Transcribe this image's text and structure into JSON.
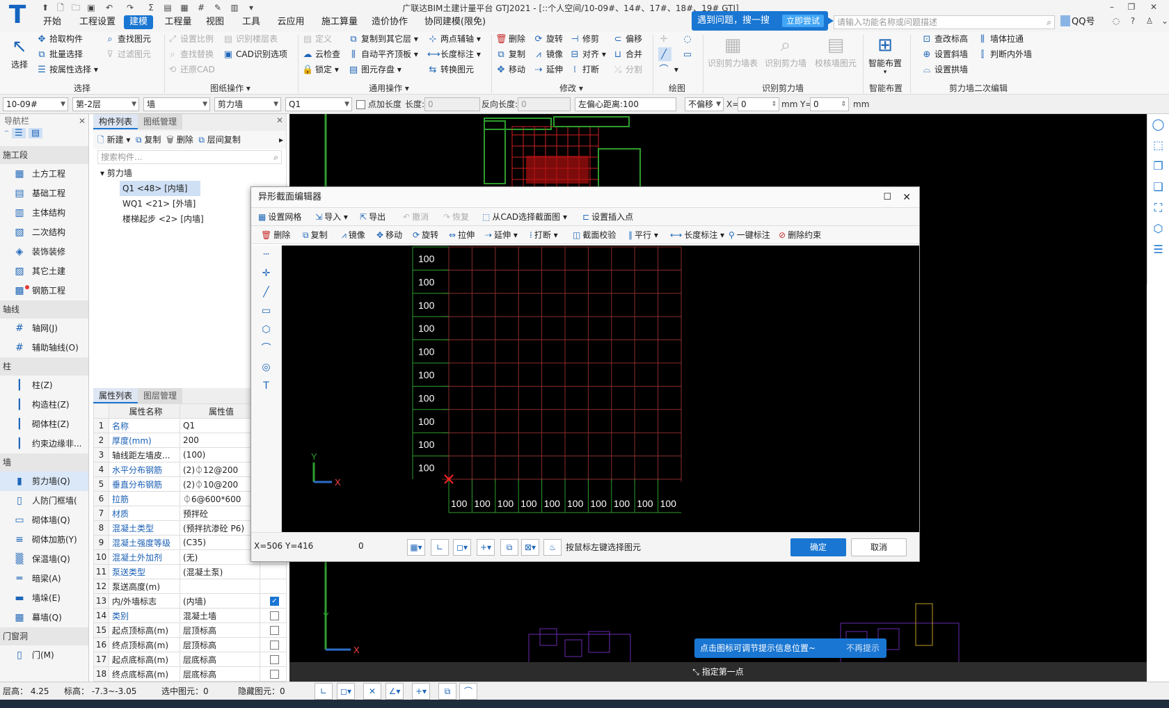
{
  "app": {
    "title": "广联达BIM土建计量平台 GTJ2021 - [::个人空间/10-09#、14#、17#、18#、19# GTJ]",
    "menus": [
      "开始",
      "工程设置",
      "建模",
      "工程量",
      "视图",
      "工具",
      "云应用",
      "施工算量",
      "造价协作",
      "协同建模(限免)"
    ],
    "active_menu": "建模",
    "promo": {
      "text": "遇到问题，搜一搜",
      "button": "立即尝试"
    },
    "search_placeholder": "请输入功能名称或问题描述",
    "account": "QQ号"
  },
  "ribbon": {
    "select": {
      "big": "选择",
      "items": [
        "拾取构件",
        "批量选择",
        "按属性选择"
      ],
      "group": "选择"
    },
    "drawing_ops": {
      "items": [
        "查找图元",
        "过滤图元",
        "设置比例",
        "识别楼层表",
        "查找替换",
        "CAD识别选项",
        "还原CAD"
      ],
      "group": "图纸操作"
    },
    "general": {
      "items": [
        "定义",
        "复制到其它层",
        "两点辅轴",
        "云检查",
        "自动平齐顶板",
        "长度标注",
        "锁定",
        "图元存盘",
        "转换图元"
      ],
      "group": "通用操作"
    },
    "modify": {
      "items": [
        "删除",
        "旋转",
        "修剪",
        "偏移",
        "复制",
        "镜像",
        "对齐",
        "合并",
        "移动",
        "延伸",
        "打断",
        "分割"
      ],
      "group": "修改"
    },
    "draw": {
      "group": "绘图"
    },
    "recognize": {
      "items": [
        "识别剪力墙表",
        "识别剪力墙",
        "校核墙图元"
      ],
      "group": "识别剪力墙"
    },
    "smart": {
      "big": "智能布置",
      "group": "智能布置"
    },
    "secondary": {
      "items": [
        "查改标高",
        "墙体拉通",
        "设置斜墙",
        "判断内外墙",
        "设置拱墙"
      ],
      "group": "剪力墙二次编辑"
    }
  },
  "propbar": {
    "floor_code": "10-09#",
    "layer": "第-2层",
    "category": "墙",
    "type": "剪力墙",
    "component": "Q1",
    "add_length_label": "点加长度",
    "length_label": "长度:",
    "length_value": "0",
    "reverse_label": "反向长度:",
    "reverse_value": "0",
    "offset_label": "左偏心距离:",
    "offset_value": "100",
    "no_offset": "不偏移",
    "x_label": "X=",
    "x_value": "0",
    "unit_mm": "mm",
    "y_label": "Y=",
    "y_value": "0",
    "unit_mm2": "mm"
  },
  "nav": {
    "title": "导航栏",
    "sections": [
      {
        "header": "施工段",
        "items": [
          {
            "label": "土方工程",
            "icon": "▦"
          },
          {
            "label": "基础工程",
            "icon": "▤"
          },
          {
            "label": "主体结构",
            "icon": "▥"
          },
          {
            "label": "二次结构",
            "icon": "▧"
          },
          {
            "label": "装饰装修",
            "icon": "◈"
          },
          {
            "label": "其它土建",
            "icon": "▨"
          },
          {
            "label": "钢筋工程",
            "icon": "▩"
          }
        ]
      },
      {
        "header": "轴线",
        "items": [
          {
            "label": "轴网(J)",
            "icon": "#"
          },
          {
            "label": "辅助轴线(O)",
            "icon": "#"
          }
        ]
      },
      {
        "header": "柱",
        "items": [
          {
            "label": "柱(Z)",
            "icon": "┃"
          },
          {
            "label": "构造柱(Z)",
            "icon": "┃"
          },
          {
            "label": "砌体柱(Z)",
            "icon": "┃"
          },
          {
            "label": "约束边缘非...",
            "icon": "┃"
          }
        ]
      },
      {
        "header": "墙",
        "items": [
          {
            "label": "剪力墙(Q)",
            "icon": "▮",
            "selected": true
          },
          {
            "label": "人防门框墙(",
            "icon": "▯"
          },
          {
            "label": "砌体墙(Q)",
            "icon": "▭"
          },
          {
            "label": "砌体加筋(Y)",
            "icon": "≡"
          },
          {
            "label": "保温墙(Q)",
            "icon": "▒"
          },
          {
            "label": "暗梁(A)",
            "icon": "═"
          },
          {
            "label": "墙垛(E)",
            "icon": "▬"
          },
          {
            "label": "幕墙(Q)",
            "icon": "▦"
          }
        ]
      },
      {
        "header": "门窗洞",
        "items": [
          {
            "label": "门(M)",
            "icon": "▯"
          }
        ]
      }
    ]
  },
  "components": {
    "tabs": [
      "构件列表",
      "图纸管理"
    ],
    "toolbar": [
      "新建",
      "复制",
      "删除",
      "层间复制"
    ],
    "search_placeholder": "搜索构件...",
    "tree_root": "剪力墙",
    "items": [
      "Q1 <48> [内墙]",
      "WQ1 <21> [外墙]",
      "楼梯起步 <2> [内墙]"
    ]
  },
  "properties": {
    "tabs": [
      "属性列表",
      "图层管理"
    ],
    "headers": [
      "属性名称",
      "属性值"
    ],
    "rows": [
      {
        "n": "1",
        "k": "名称",
        "v": "Q1",
        "blue": true,
        "check": ""
      },
      {
        "n": "2",
        "k": "厚度(mm)",
        "v": "200",
        "blue": true,
        "check": ""
      },
      {
        "n": "3",
        "k": "轴线距左墙皮...",
        "v": "(100)",
        "blue": false,
        "check": ""
      },
      {
        "n": "4",
        "k": "水平分布钢筋",
        "v": "(2)⏀12@200",
        "blue": true,
        "check": ""
      },
      {
        "n": "5",
        "k": "垂直分布钢筋",
        "v": "(2)⏀10@200",
        "blue": true,
        "check": ""
      },
      {
        "n": "6",
        "k": "拉筋",
        "v": "⏀6@600*600",
        "blue": true,
        "check": ""
      },
      {
        "n": "7",
        "k": "材质",
        "v": "预拌砼",
        "blue": true,
        "check": ""
      },
      {
        "n": "8",
        "k": "混凝土类型",
        "v": "(预拌抗渗砼 P6)",
        "blue": true,
        "check": ""
      },
      {
        "n": "9",
        "k": "混凝土强度等级",
        "v": "(C35)",
        "blue": true,
        "check": ""
      },
      {
        "n": "10",
        "k": "混凝土外加剂",
        "v": "(无)",
        "blue": true,
        "check": ""
      },
      {
        "n": "11",
        "k": "泵送类型",
        "v": "(混凝土泵)",
        "blue": true,
        "check": ""
      },
      {
        "n": "12",
        "k": "泵送高度(m)",
        "v": "",
        "blue": false,
        "check": ""
      },
      {
        "n": "13",
        "k": "内/外墙标志",
        "v": "(内墙)",
        "blue": false,
        "check": "on"
      },
      {
        "n": "14",
        "k": "类别",
        "v": "混凝土墙",
        "blue": true,
        "check": "off"
      },
      {
        "n": "15",
        "k": "起点顶标高(m)",
        "v": "层顶标高",
        "blue": false,
        "check": "off"
      },
      {
        "n": "16",
        "k": "终点顶标高(m)",
        "v": "层顶标高",
        "blue": false,
        "check": "off"
      },
      {
        "n": "17",
        "k": "起点底标高(m)",
        "v": "层底标高",
        "blue": false,
        "check": "off"
      },
      {
        "n": "18",
        "k": "终点底标高(m)",
        "v": "层底标高",
        "blue": false,
        "check": "off"
      }
    ]
  },
  "dialog": {
    "title": "异形截面编辑器",
    "toolbar1": [
      "设置网格",
      "导入",
      "导出",
      "撤消",
      "恢复",
      "从CAD选择截面图",
      "设置插入点"
    ],
    "toolbar2": [
      "删除",
      "复制",
      "镜像",
      "移动",
      "旋转",
      "拉伸",
      "延伸",
      "打断",
      "截面校验",
      "平行",
      "长度标注",
      "一键标注",
      "删除约束"
    ],
    "grid_label": "100",
    "coords": "X=506 Y=416",
    "zero": "0",
    "hint": "按鼠标左键选择图元",
    "ok": "确定",
    "cancel": "取消"
  },
  "canvas": {
    "tip": "点击图标可调节提示信息位置~",
    "tip_dismiss": "不再提示",
    "command": "指定第一点"
  },
  "axis": {
    "x": "X",
    "y": "Y"
  },
  "status": {
    "floor_height": "层高： 4.25",
    "elevation": "标高： -7.3~-3.05",
    "selected": "选中图元：0",
    "hidden": "隐藏图元：0"
  },
  "colors": {
    "accent": "#1976d2",
    "grid_line": "#8b2d2d",
    "axis_green": "#2e9e2e",
    "marker_red": "#ff2222"
  }
}
